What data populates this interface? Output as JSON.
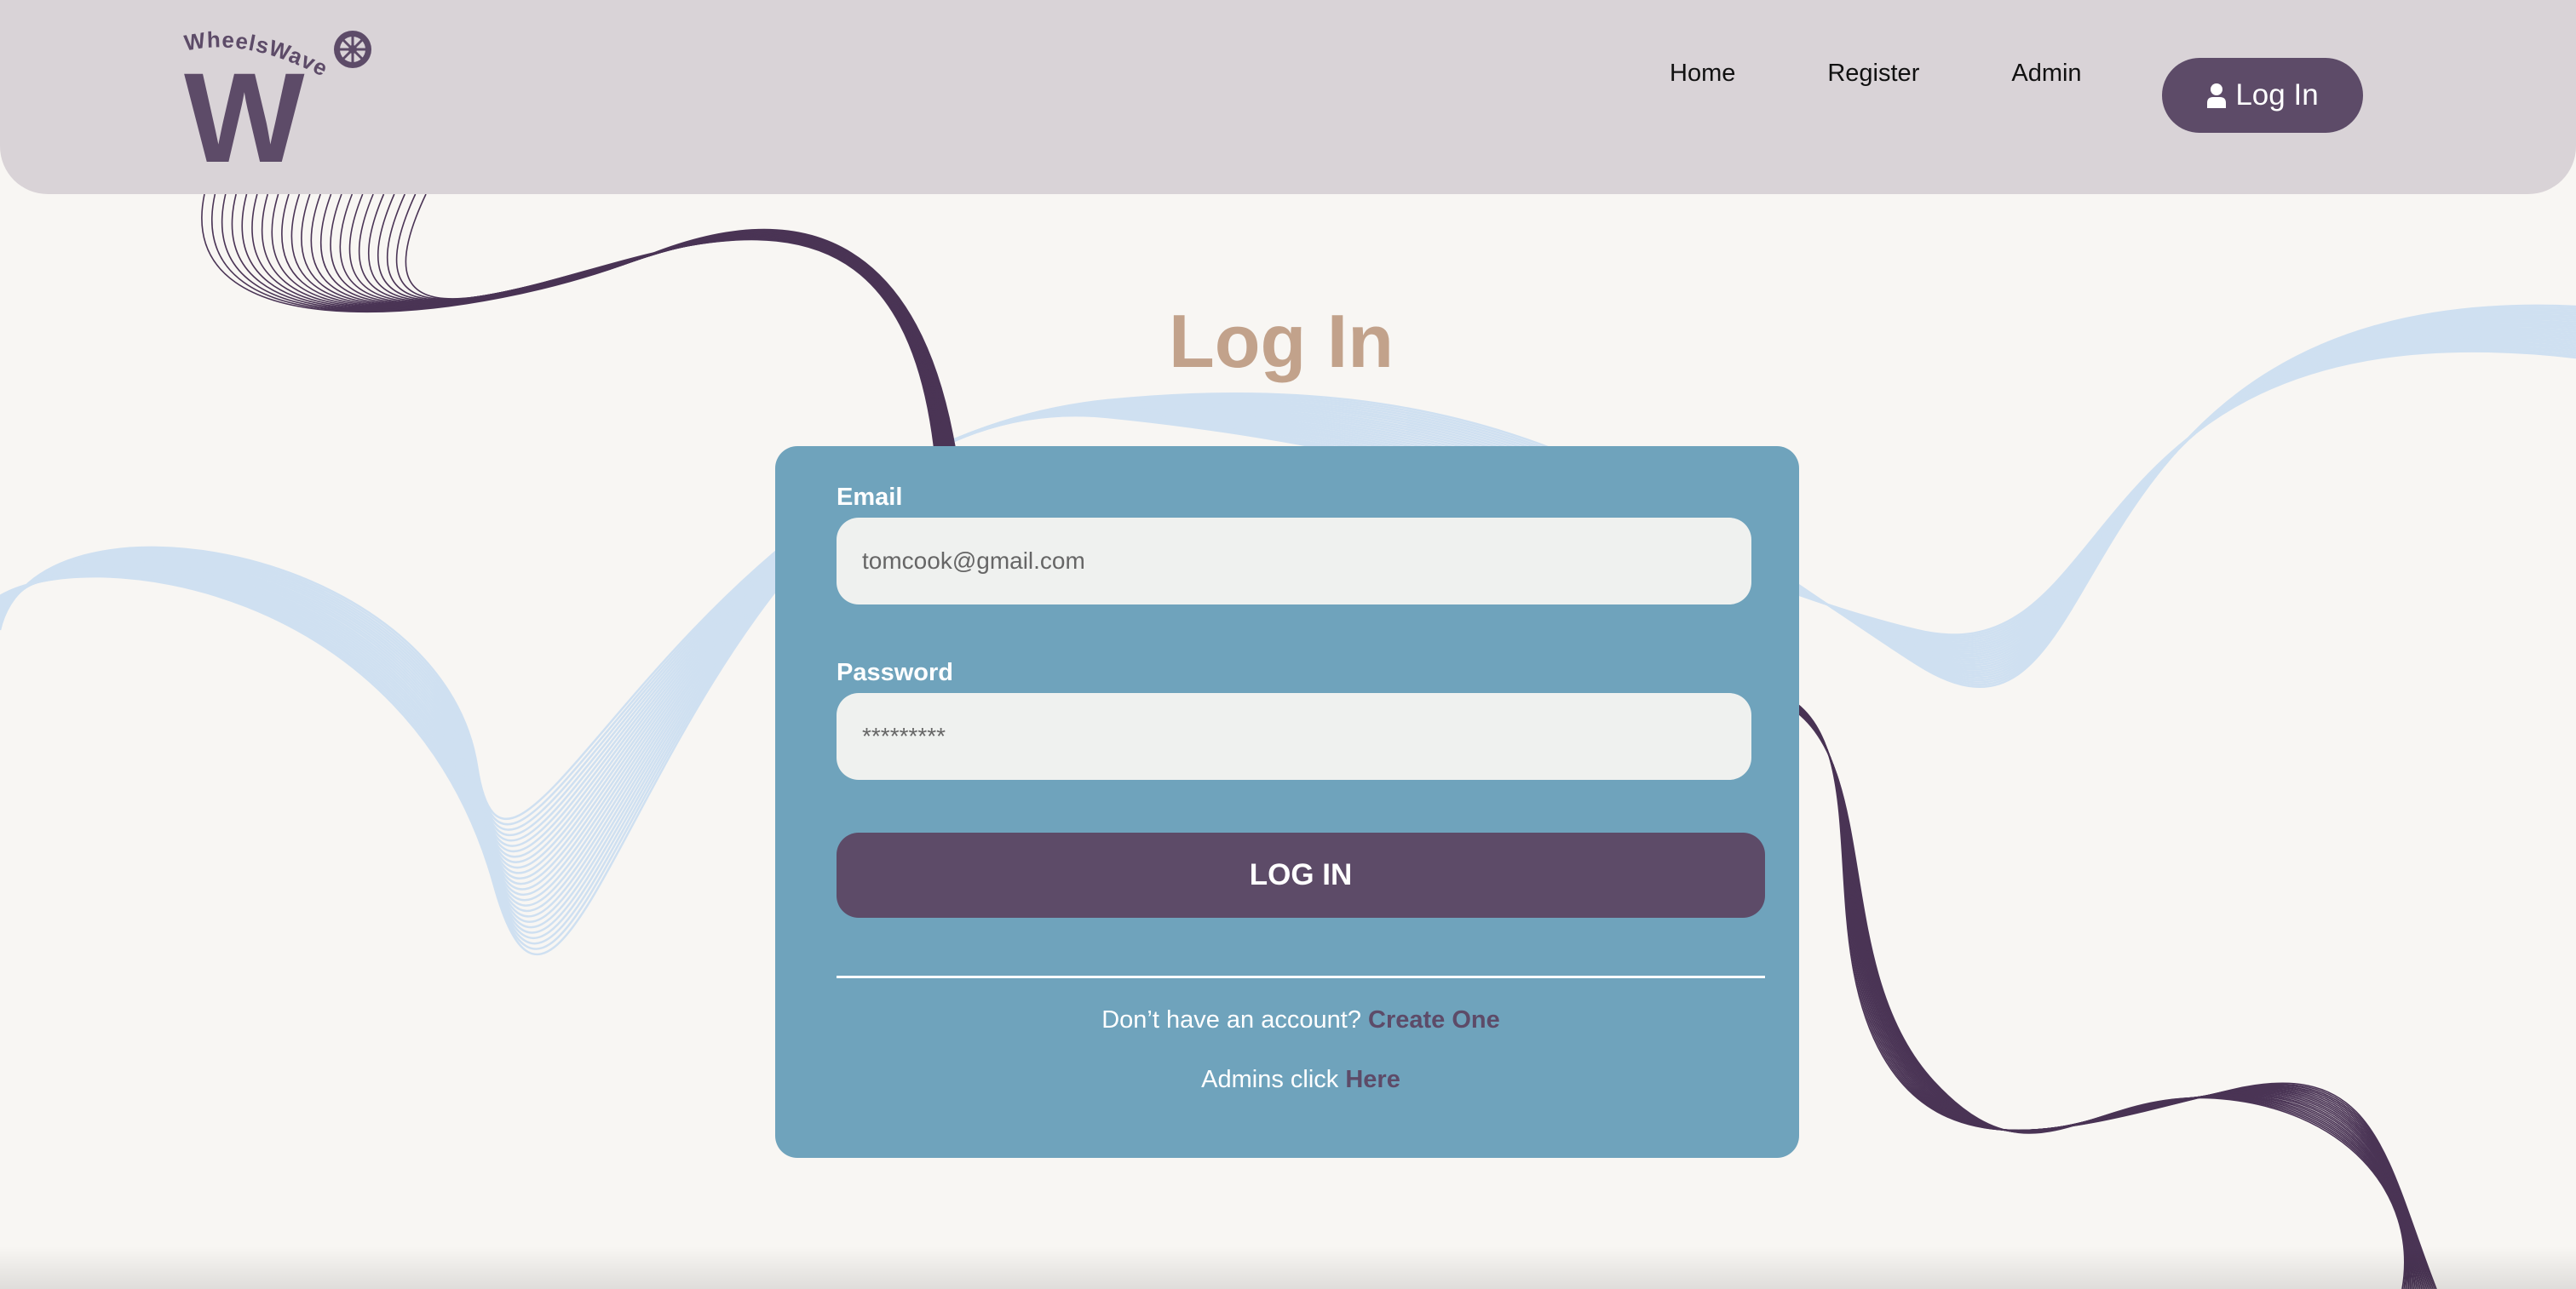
{
  "brand": {
    "logo_text": "WheelsWave",
    "logo_letter": "W",
    "color_primary": "#5d4b68",
    "color_accent": "#c2a28b",
    "color_card": "#6fa3bc",
    "color_nav": "#d9d3d7"
  },
  "nav": {
    "links": [
      {
        "label": "Home"
      },
      {
        "label": "Register"
      },
      {
        "label": "Admin"
      }
    ],
    "login_button": {
      "label": "Log In",
      "icon": "user-icon"
    }
  },
  "main": {
    "title": "Log In",
    "form": {
      "email_label": "Email",
      "email_value": "tomcook@gmail.com",
      "password_label": "Password",
      "password_value": "*********",
      "submit_label": "LOG IN"
    },
    "signup": {
      "prompt": "Don’t have an account?",
      "link": "Create One"
    },
    "admin": {
      "prompt": "Admins click",
      "link": "Here"
    }
  }
}
